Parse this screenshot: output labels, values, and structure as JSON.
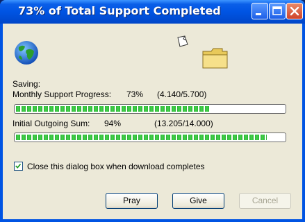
{
  "window": {
    "title": "73% of Total Support Completed"
  },
  "status": {
    "saving_label": "Saving:"
  },
  "progress": {
    "monthly": {
      "label": "Monthly Support Progress:",
      "percent_text": "73%",
      "amount_text": "(4.140/5.700)",
      "fraction": 0.73
    },
    "initial": {
      "label": "Initial Outgoing Sum:",
      "percent_text": "94%",
      "amount_text": "(13.205/14.000)",
      "fraction": 0.94
    }
  },
  "options": {
    "close_when_done_label": "Close this dialog box when download completes",
    "close_when_done_checked": true
  },
  "buttons": {
    "pray_label": "Pray",
    "give_label": "Give",
    "cancel_label": "Cancel"
  },
  "icons": {
    "globe": "globe-icon",
    "page": "flying-page-icon",
    "folder": "folder-icon",
    "minimize": "minimize-icon",
    "maximize": "maximize-icon",
    "close": "close-icon"
  },
  "colors": {
    "titlebar": "#0054e3",
    "progress_green": "#2ab336",
    "client_bg": "#ece9d8"
  }
}
